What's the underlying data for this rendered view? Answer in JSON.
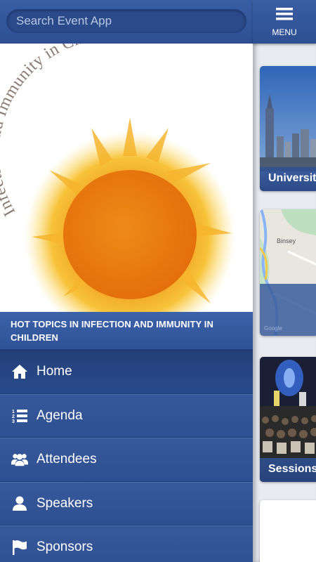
{
  "search": {
    "placeholder": "Search Event App"
  },
  "hero": {
    "logo_text": "Infection and Immunity in Children"
  },
  "event": {
    "title": "HOT TOPICS IN INFECTION AND IMMUNITY IN CHILDREN"
  },
  "nav": {
    "items": [
      {
        "label": "Home",
        "icon": "home-icon",
        "active": true
      },
      {
        "label": "Agenda",
        "icon": "numbered-list-icon",
        "active": false
      },
      {
        "label": "Attendees",
        "icon": "users-group-icon",
        "active": false
      },
      {
        "label": "Speakers",
        "icon": "user-icon",
        "active": false
      },
      {
        "label": "Sponsors",
        "icon": "flag-icon",
        "active": false
      }
    ]
  },
  "header": {
    "menu_label": "MENU"
  },
  "tiles": [
    {
      "label": "University",
      "image": "city-skyline"
    },
    {
      "label": "",
      "image": "map"
    },
    {
      "label": "Sessions",
      "image": "conference-hall"
    },
    {
      "label": "",
      "image": "blank"
    }
  ],
  "map": {
    "place_label": "Binsey",
    "watermark": "Google"
  },
  "colors": {
    "primary": "#2f5296",
    "accent": "#3c62aa",
    "sun_orange": "#f0a020"
  }
}
